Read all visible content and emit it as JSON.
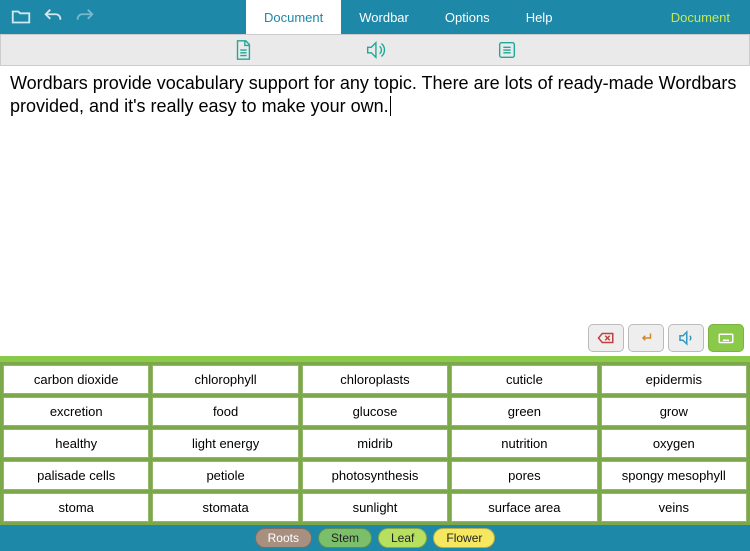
{
  "header": {
    "tabs": [
      "Document",
      "Wordbar",
      "Options",
      "Help"
    ],
    "activeTab": 0,
    "rightLabel": "Document"
  },
  "document": {
    "text": "Wordbars provide vocabulary support for any topic. There are lots of ready-made Wordbars provided, and it's really easy to make your own."
  },
  "wordbar": {
    "words": [
      "carbon dioxide",
      "chlorophyll",
      "chloroplasts",
      "cuticle",
      "epidermis",
      "excretion",
      "food",
      "glucose",
      "green",
      "grow",
      "healthy",
      "light energy",
      "midrib",
      "nutrition",
      "oxygen",
      "palisade cells",
      "petiole",
      "photosynthesis",
      "pores",
      "spongy mesophyll",
      "stoma",
      "stomata",
      "sunlight",
      "surface area",
      "veins"
    ],
    "categories": [
      "Roots",
      "Stem",
      "Leaf",
      "Flower"
    ],
    "activeCategory": 2
  }
}
